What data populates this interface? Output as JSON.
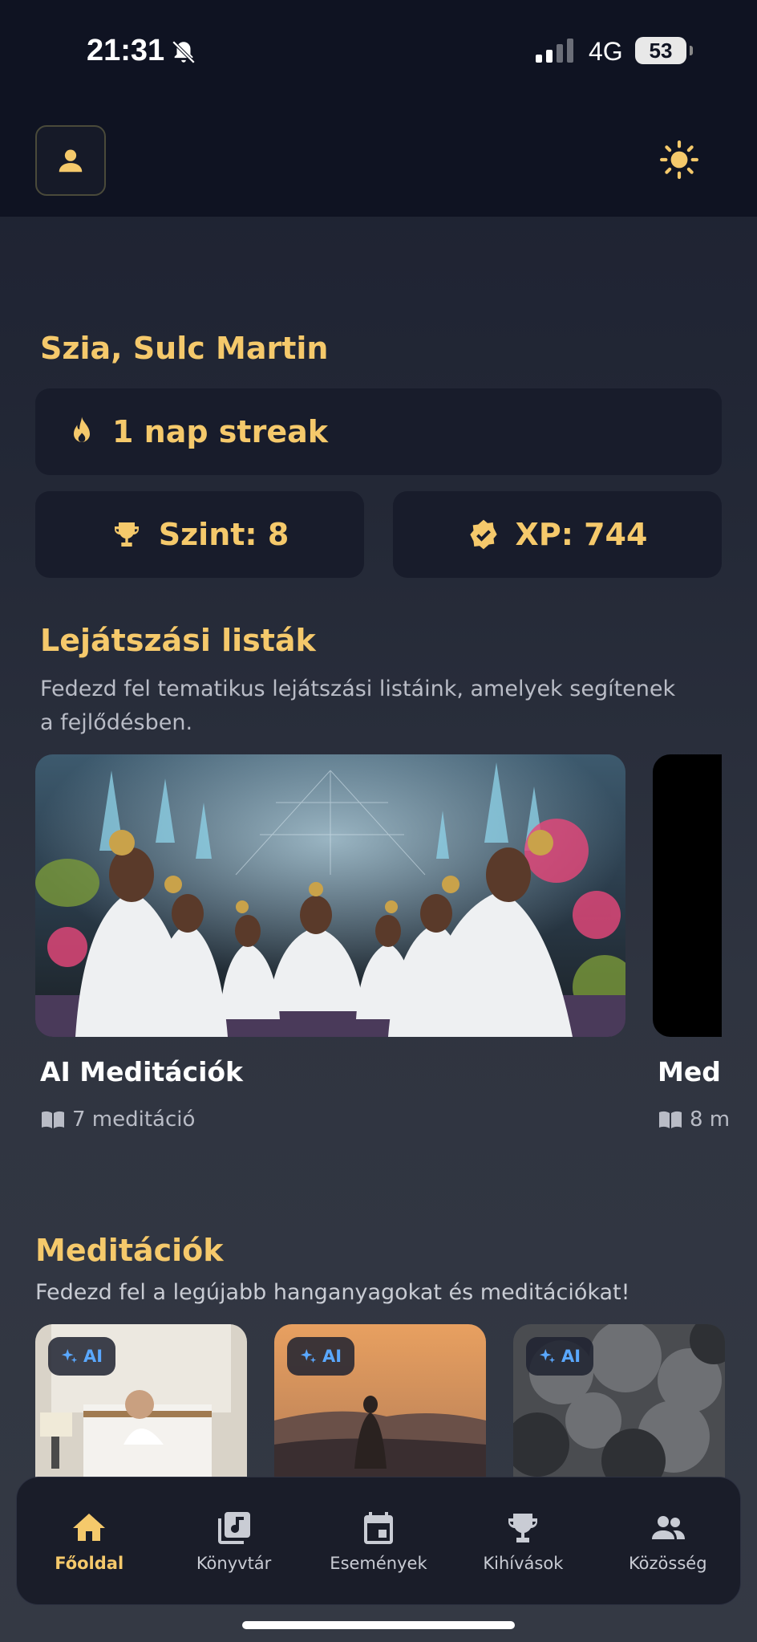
{
  "status_bar": {
    "time": "21:31",
    "network": "4G",
    "battery": "53"
  },
  "profile": {
    "greeting": "Szia, Sulc Martin"
  },
  "stats": {
    "streak": "1 nap streak",
    "level": "Szint: 8",
    "xp": "XP: 744"
  },
  "playlists": {
    "title": "Lejátszási listák",
    "subtitle_line1": "Fedezd fel tematikus lejátszási listáink, amelyek segítenek",
    "subtitle_line2": "a fejlődésben.",
    "items": [
      {
        "title": "AI Meditációk",
        "count": "7 meditáció"
      },
      {
        "title": "Med",
        "count": "8 m"
      }
    ]
  },
  "meditations": {
    "title": "Meditációk",
    "subtitle": "Fedezd fel a legújabb hanganyagokat és meditációkat!",
    "badge": "AI"
  },
  "nav": {
    "items": [
      {
        "label": "Főoldal",
        "icon": "home-icon",
        "active": true
      },
      {
        "label": "Könyvtár",
        "icon": "library-music-icon"
      },
      {
        "label": "Események",
        "icon": "calendar-icon"
      },
      {
        "label": "Kihívások",
        "icon": "trophy-icon"
      },
      {
        "label": "Közösség",
        "icon": "people-icon"
      }
    ]
  },
  "colors": {
    "accent": "#f5c96b",
    "background": "#0f1322",
    "card": "#181c2b",
    "ai_badge": "#5aa8ff"
  }
}
